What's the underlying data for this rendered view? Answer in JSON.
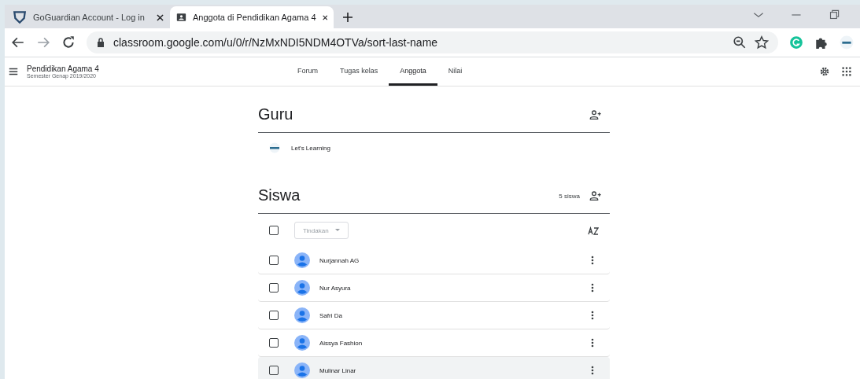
{
  "browser_tabs": [
    {
      "title": "GoGuardian Account - Log in",
      "selected": false,
      "kind": "shield"
    },
    {
      "title": "Anggota di Pendidikan Agama 4",
      "selected": true,
      "kind": "classroom"
    }
  ],
  "address_bar": {
    "url": "classroom.google.com/u/0/r/NzMxNDI5NDM4OTVa/sort-last-name"
  },
  "class_header": {
    "title": "Pendidikan Agama 4",
    "subtitle": "Semester Genap 2019/2020"
  },
  "nav_tabs": [
    {
      "label": "Forum",
      "selected": false
    },
    {
      "label": "Tugas kelas",
      "selected": false
    },
    {
      "label": "Anggota",
      "selected": true
    },
    {
      "label": "Nilai",
      "selected": false
    }
  ],
  "teachers": {
    "heading": "Guru",
    "members": [
      {
        "name": "Let's Learning"
      }
    ]
  },
  "students": {
    "heading": "Siswa",
    "count": "5 siswa",
    "actions_placeholder": "Tindakan",
    "select_all_checked": false,
    "rows": [
      {
        "name": "Nurjannah AG",
        "checked": false,
        "highlighted": false
      },
      {
        "name": "Nur Asyura",
        "checked": false,
        "highlighted": false
      },
      {
        "name": "Safri Da",
        "checked": false,
        "highlighted": false
      },
      {
        "name": "Aissya Fashion",
        "checked": false,
        "highlighted": false
      },
      {
        "name": "Mulinar Linar",
        "checked": false,
        "highlighted": true
      }
    ]
  }
}
